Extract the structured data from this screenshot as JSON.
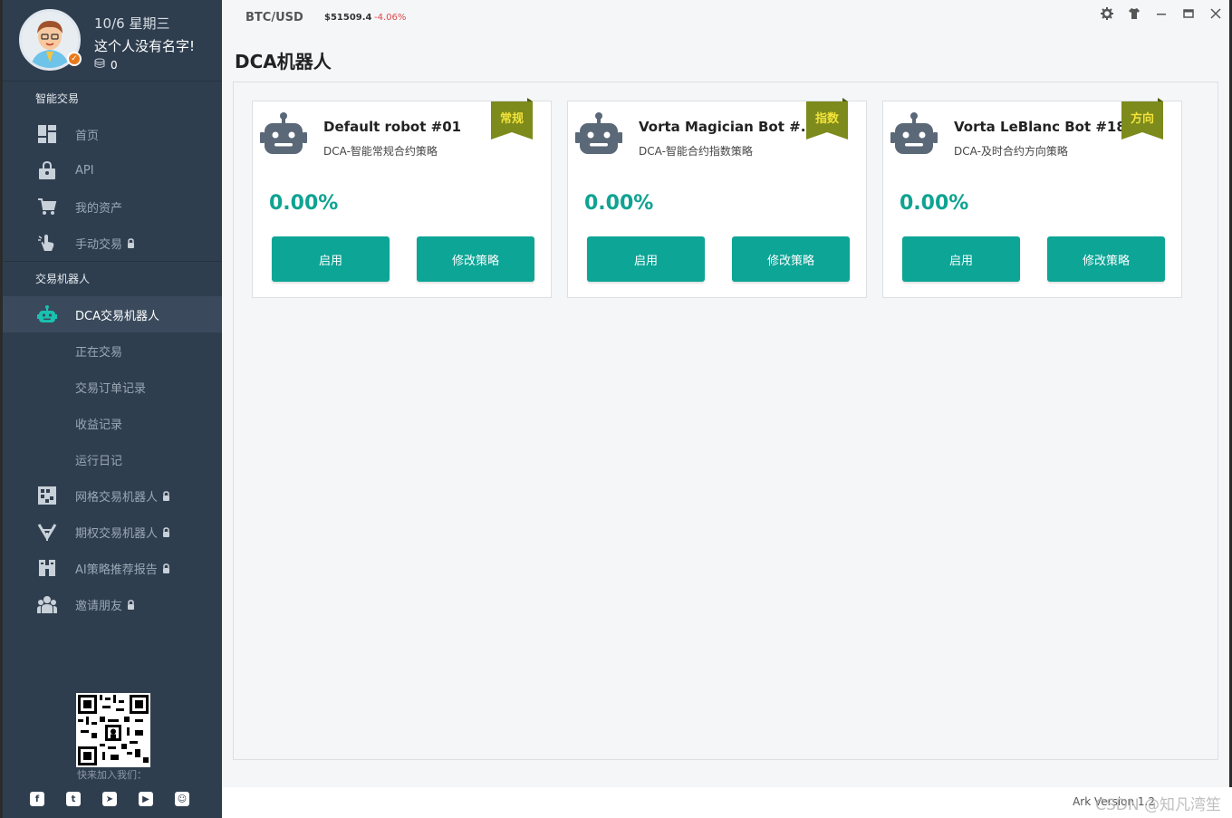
{
  "profile": {
    "date": "10/6 星期三",
    "name": "这个人没有名字!",
    "coins": "0"
  },
  "sidebar": {
    "sections": [
      {
        "title": "智能交易"
      },
      {
        "title": "交易机器人"
      }
    ],
    "items": [
      [
        {
          "label": "首页",
          "icon": "dashboard-icon"
        },
        {
          "label": "API",
          "icon": "lock-box-icon"
        },
        {
          "label": "我的资产",
          "icon": "cart-icon"
        },
        {
          "label": "手动交易",
          "icon": "hand-cursor-icon",
          "locked": true
        }
      ],
      [
        {
          "label": "DCA交易机器人",
          "icon": "robot-icon",
          "active": true
        },
        {
          "label": "正在交易",
          "sub": true
        },
        {
          "label": "交易订单记录",
          "sub": true
        },
        {
          "label": "收益记录",
          "sub": true
        },
        {
          "label": "运行日记",
          "sub": true
        },
        {
          "label": "网格交易机器人",
          "icon": "grid-icon",
          "locked": true
        },
        {
          "label": "期权交易机器人",
          "icon": "options-icon",
          "locked": true
        },
        {
          "label": "AI策略推荐报告",
          "icon": "report-icon",
          "locked": true
        },
        {
          "label": "邀请朋友",
          "icon": "people-icon",
          "locked": true
        }
      ]
    ],
    "qr_caption": "快来加入我们：",
    "social": [
      "facebook-icon",
      "twitter-icon",
      "telegram-icon",
      "youtube-icon",
      "discord-icon"
    ]
  },
  "topbar": {
    "pair": "BTC/USD",
    "price": "$51509.4",
    "change": "-4.06%"
  },
  "page": {
    "title": "DCA机器人"
  },
  "cards": [
    {
      "name": "Default robot #01",
      "strategy": "DCA-智能常规合约策略",
      "tag": "常规",
      "pct": "0.00%",
      "enable_label": "启用",
      "edit_label": "修改策略"
    },
    {
      "name": "Vorta Magician Bot #...",
      "strategy": "DCA-智能合约指数策略",
      "tag": "指数",
      "pct": "0.00%",
      "enable_label": "启用",
      "edit_label": "修改策略"
    },
    {
      "name": "Vorta LeBlanc Bot #18",
      "strategy": "DCA-及时合约方向策略",
      "tag": "方向",
      "pct": "0.00%",
      "enable_label": "启用",
      "edit_label": "修改策略"
    }
  ],
  "footer": {
    "version": "Ark  Version 1.2",
    "watermark": "CSDN @知凡湾笙"
  },
  "colors": {
    "sidebar_bg": "#2f3e4f",
    "accent": "#0ca596",
    "negative": "#e04848",
    "ribbon": "#7d8a1c"
  }
}
